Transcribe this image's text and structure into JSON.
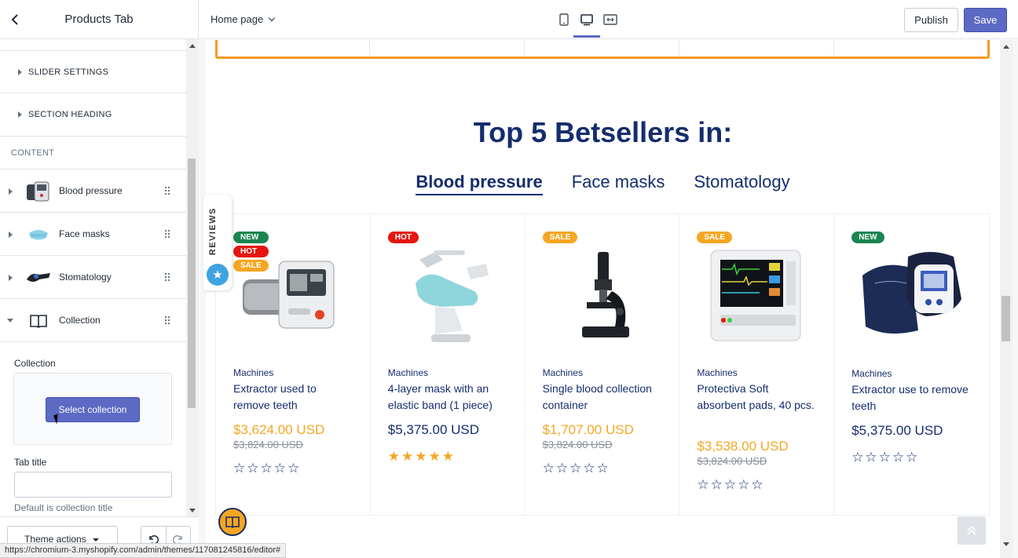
{
  "sidebar": {
    "title": "Products Tab",
    "sections": [
      "SLIDER SETTINGS",
      "SECTION HEADING"
    ],
    "content_heading": "CONTENT",
    "blocks": [
      {
        "label": "Blood pressure",
        "icon": "blood-pressure-monitor-icon"
      },
      {
        "label": "Face masks",
        "icon": "face-mask-icon"
      },
      {
        "label": "Stomatology",
        "icon": "dental-icon"
      },
      {
        "label": "Collection",
        "icon": "book-icon"
      }
    ],
    "collection_label": "Collection",
    "select_collection": "Select collection",
    "tab_title_label": "Tab title",
    "tab_title_value": "",
    "tab_title_help": "Default is collection title",
    "theme_actions": "Theme actions"
  },
  "topbar": {
    "page": "Home page",
    "publish": "Publish",
    "save": "Save"
  },
  "preview": {
    "heading": "Top 5 Betsellers in:",
    "tabs": [
      "Blood pressure",
      "Face masks",
      "Stomatology"
    ],
    "reviews": "REVIEWS",
    "products": [
      {
        "badges": [
          "NEW",
          "HOT",
          "SALE"
        ],
        "category": "Machines",
        "name": "Extractor used to remove teeth",
        "price": "$3,624.00 USD",
        "old_price": "$3,824.00 USD",
        "rating": 0
      },
      {
        "badges": [
          "HOT"
        ],
        "category": "Machines",
        "name": "4-layer mask with an elastic band (1 piece)",
        "price": "$5,375.00 USD",
        "old_price": "",
        "rating": 5
      },
      {
        "badges": [
          "SALE"
        ],
        "category": "Machines",
        "name": "Single blood collection container",
        "price": "$1,707.00 USD",
        "old_price": "$3,824.00 USD",
        "rating": 0
      },
      {
        "badges": [
          "SALE"
        ],
        "category": "Machines",
        "name": "Protectiva Soft absorbent pads, 40 pcs.",
        "price": "$3,538.00 USD",
        "old_price": "$3,824.00 USD",
        "rating": 0
      },
      {
        "badges": [
          "NEW"
        ],
        "category": "Machines",
        "name": "Extractor use to remove teeth",
        "price": "$5,375.00 USD",
        "old_price": "",
        "rating": 0
      }
    ]
  },
  "status_url": "https://chromium-3.myshopify.com/admin/themes/117081245816/editor#",
  "colors": {
    "accent": "#5c6ac4",
    "navy": "#152d6e",
    "sale": "#f5a623",
    "new": "#1a8550",
    "hot": "#e4160f",
    "border_orange": "#f49a24"
  }
}
